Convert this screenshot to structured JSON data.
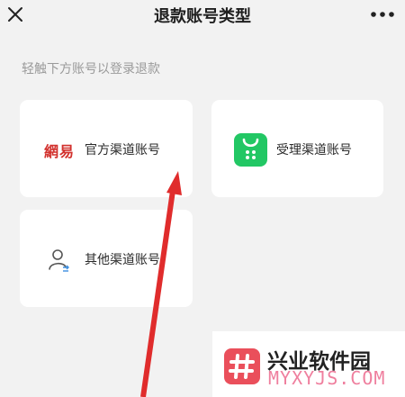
{
  "header": {
    "title": "退款账号类型",
    "close_icon": "close-icon",
    "more_icon": "more-icon"
  },
  "hint": "轻触下方账号以登录退款",
  "cards": [
    {
      "label": "官方渠道账号",
      "logo_text": "網易",
      "logo_color": "#d2312d"
    },
    {
      "label": "受理渠道账号",
      "icon": "shopping-bag-icon",
      "icon_color": "#22c764"
    },
    {
      "label": "其他渠道账号",
      "icon": "user-transfer-icon"
    }
  ],
  "watermark": {
    "title": "兴业软件园",
    "domain": "MYXYJS.COM",
    "logo_color": "#ea4f5b"
  },
  "arrow": {
    "color": "#e02c2c"
  }
}
